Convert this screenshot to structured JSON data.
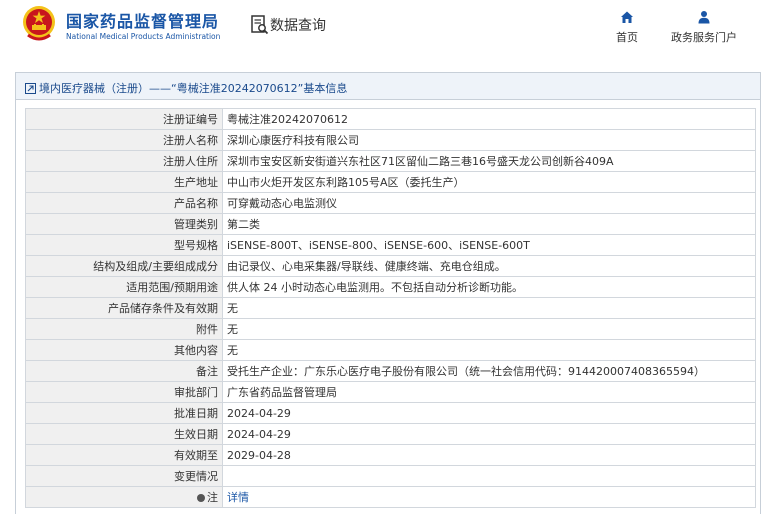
{
  "header": {
    "brand_cn": "国家药品监督管理局",
    "brand_en": "National Medical Products Administration",
    "search_label": "数据查询",
    "nav": [
      {
        "label": "首页",
        "icon": "home-icon"
      },
      {
        "label": "政务服务门户",
        "icon": "user-icon"
      }
    ]
  },
  "breadcrumb": "境内医疗器械（注册）——“粤械注准20242070612”基本信息",
  "rows": [
    {
      "label": "注册证编号",
      "value": "粤械注准20242070612"
    },
    {
      "label": "注册人名称",
      "value": "深圳心康医疗科技有限公司"
    },
    {
      "label": "注册人住所",
      "value": "深圳市宝安区新安街道兴东社区71区留仙二路三巷16号盛天龙公司创新谷409A"
    },
    {
      "label": "生产地址",
      "value": "中山市火炬开发区东利路105号A区（委托生产）"
    },
    {
      "label": "产品名称",
      "value": "可穿戴动态心电监测仪"
    },
    {
      "label": "管理类别",
      "value": "第二类"
    },
    {
      "label": "型号规格",
      "value": "iSENSE-800T、iSENSE-800、iSENSE-600、iSENSE-600T"
    },
    {
      "label": "结构及组成/主要组成成分",
      "value": "由记录仪、心电采集器/导联线、健康终端、充电仓组成。"
    },
    {
      "label": "适用范围/预期用途",
      "value": "供人体 24 小时动态心电监测用。不包括自动分析诊断功能。"
    },
    {
      "label": "产品储存条件及有效期",
      "value": "无"
    },
    {
      "label": "附件",
      "value": "无"
    },
    {
      "label": "其他内容",
      "value": "无"
    },
    {
      "label": "备注",
      "value": "受托生产企业：广东乐心医疗电子股份有限公司（统一社会信用代码：91442000740836559​4）"
    },
    {
      "label": "审批部门",
      "value": "广东省药品监督管理局"
    },
    {
      "label": "批准日期",
      "value": "2024-04-29"
    },
    {
      "label": "生效日期",
      "value": "2024-04-29"
    },
    {
      "label": "有效期至",
      "value": "2029-04-28"
    },
    {
      "label": "变更情况",
      "value": ""
    }
  ],
  "note_row": {
    "label": "注",
    "link": "详情"
  },
  "colors": {
    "brand": "#1a56a6",
    "label_bg": "#f0f0f0",
    "panel_head_bg": "#eef3f9",
    "emblem_red": "#c8161d",
    "emblem_gold": "#f4c21a"
  }
}
